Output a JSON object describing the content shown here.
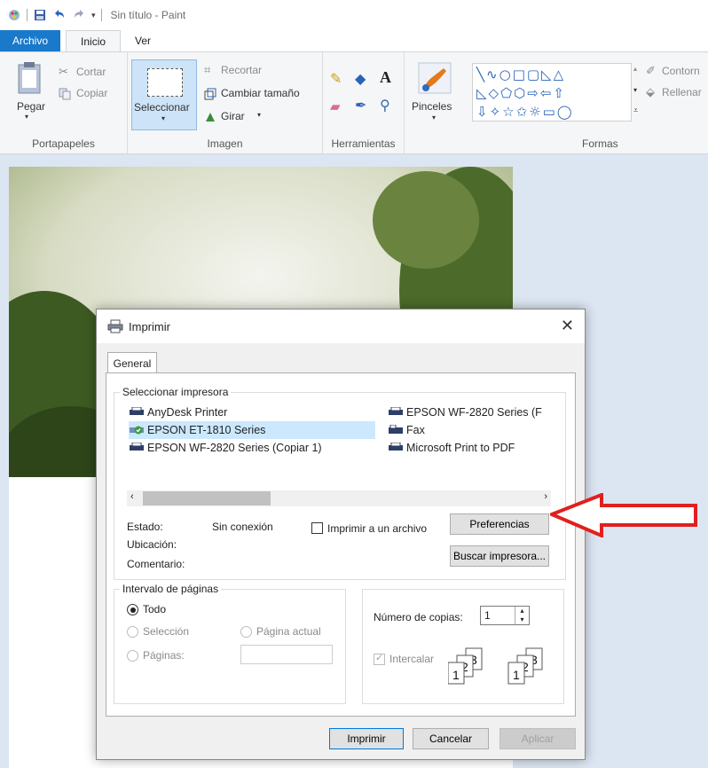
{
  "window": {
    "title": "Sin título - Paint"
  },
  "tabs": [
    {
      "label": "Archivo"
    },
    {
      "label": "Inicio"
    },
    {
      "label": "Ver"
    }
  ],
  "ribbon": {
    "clipboard": {
      "paste": "Pegar",
      "cut": "Cortar",
      "copy": "Copiar",
      "group": "Portapapeles"
    },
    "image": {
      "select": "Seleccionar",
      "crop": "Recortar",
      "resize": "Cambiar tamaño",
      "rotate": "Girar",
      "group": "Imagen"
    },
    "tools": {
      "group": "Herramientas"
    },
    "brushes": {
      "label": "Pinceles"
    },
    "shapes": {
      "outline": "Contorn",
      "fill": "Rellenar",
      "group": "Formas"
    }
  },
  "dialog": {
    "title": "Imprimir",
    "tab": "General",
    "printer_group": "Seleccionar impresora",
    "printers": [
      {
        "name": "AnyDesk Printer"
      },
      {
        "name": "EPSON WF-2820 Series (F"
      },
      {
        "name": "EPSON ET-1810 Series",
        "selected": true
      },
      {
        "name": "Fax"
      },
      {
        "name": "EPSON WF-2820 Series (Copiar 1)"
      },
      {
        "name": "Microsoft Print to PDF"
      }
    ],
    "status_label": "Estado:",
    "status_value": "Sin conexión",
    "location_label": "Ubicación:",
    "comment_label": "Comentario:",
    "print_to_file": "Imprimir a un archivo",
    "preferences": "Preferencias",
    "find_printer": "Buscar impresora...",
    "range_group": "Intervalo de páginas",
    "range_all": "Todo",
    "range_selection": "Selección",
    "range_current": "Página actual",
    "range_pages": "Páginas:",
    "copies_label": "Número de copias:",
    "copies_value": "1",
    "collate": "Intercalar",
    "btn_print": "Imprimir",
    "btn_cancel": "Cancelar",
    "btn_apply": "Aplicar"
  }
}
